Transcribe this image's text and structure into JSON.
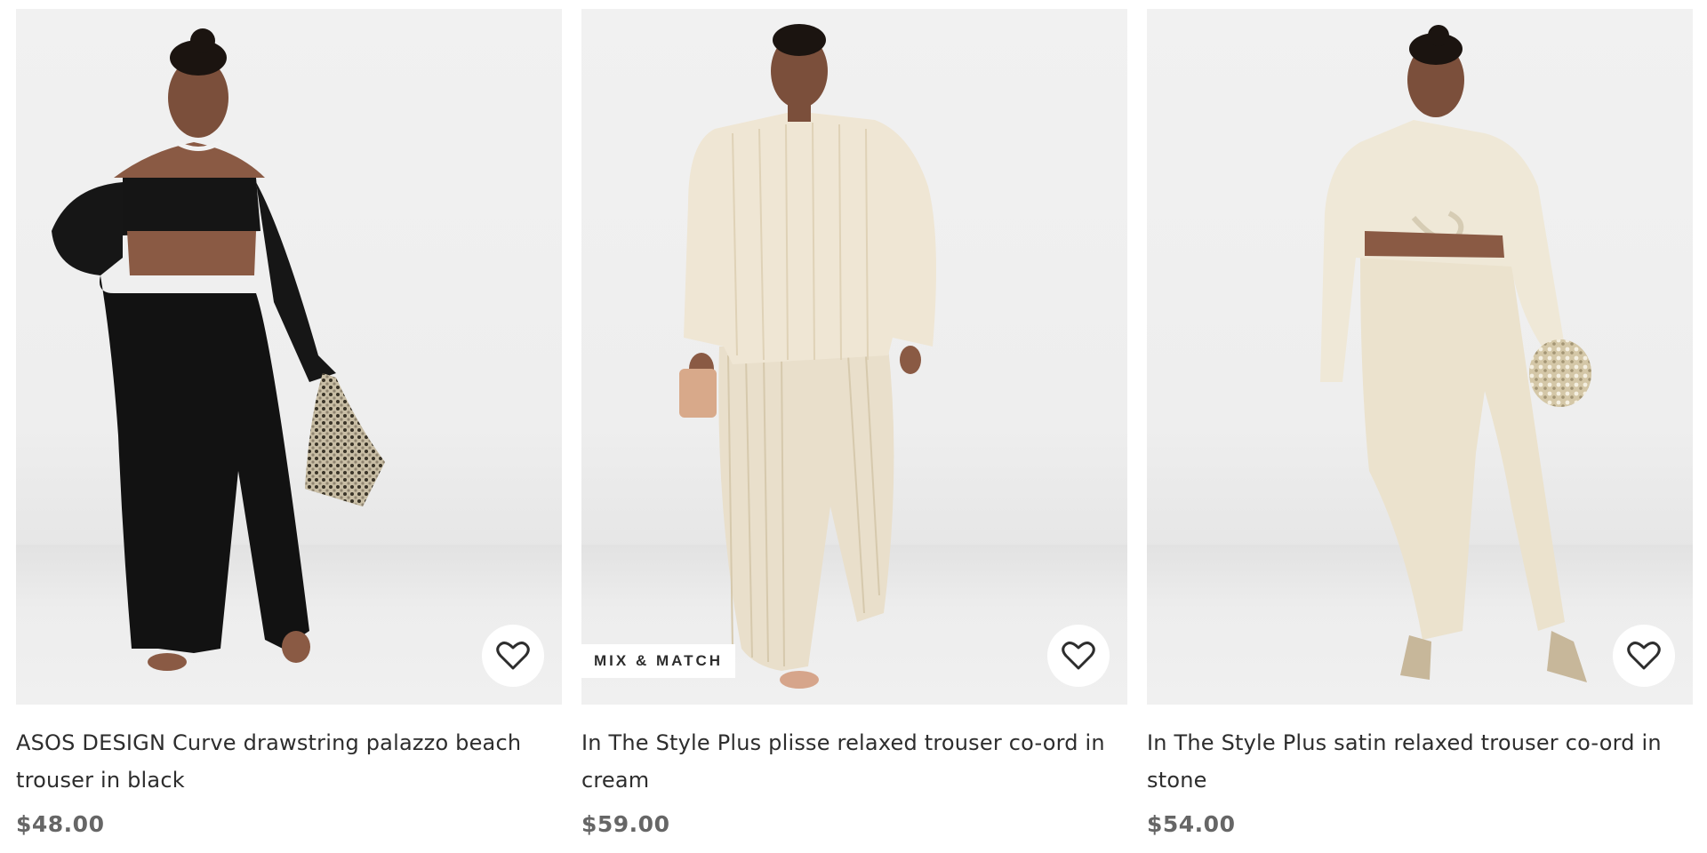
{
  "products": [
    {
      "title": "ASOS DESIGN Curve drawstring palazzo beach trouser in black",
      "price": "$48.00",
      "image_alt": "ASOS DESIGN Curve drawstring palazzo beach trouser in black",
      "outfit_color": "#111111",
      "accent_color": "#d9cdb4",
      "badge": "",
      "wishlist_icon": "heart-outline-icon"
    },
    {
      "title": "In The Style Plus plisse relaxed trouser co-ord in cream",
      "price": "$59.00",
      "image_alt": "In The Style Plus plisse relaxed trouser co-ord in cream",
      "outfit_color": "#ede3d1",
      "accent_color": "#d8a98a",
      "badge": "MIX & MATCH",
      "wishlist_icon": "heart-outline-icon"
    },
    {
      "title": "In The Style Plus satin relaxed trouser co-ord in stone",
      "price": "$54.00",
      "image_alt": "In The Style Plus satin relaxed trouser co-ord in stone",
      "outfit_color": "#ece4d0",
      "accent_color": "#cfc6b3",
      "badge": "",
      "wishlist_icon": "heart-outline-icon"
    }
  ]
}
